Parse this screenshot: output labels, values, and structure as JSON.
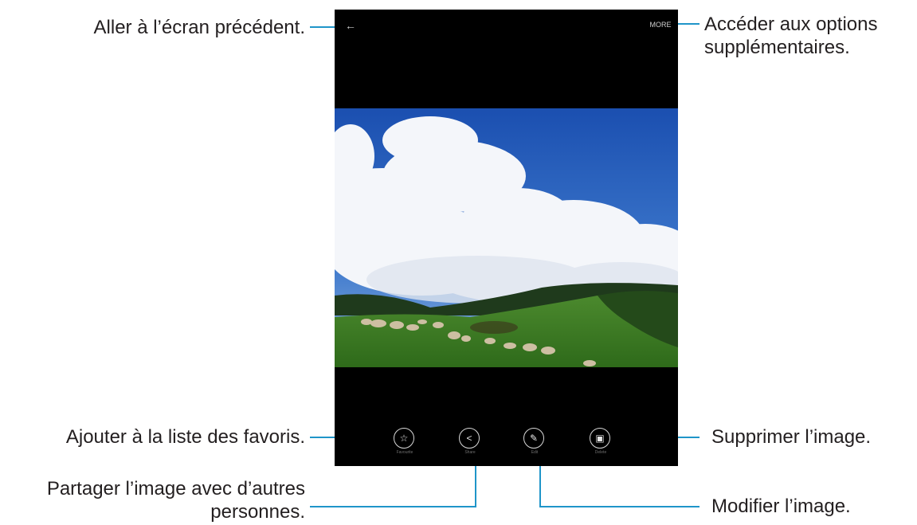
{
  "callouts": {
    "back": "Aller à l’écran précédent.",
    "more": [
      "Accéder aux options",
      "supplémentaires."
    ],
    "favorite": "Ajouter à la liste des favoris.",
    "share": [
      "Partager l’image avec d’autres",
      "personnes."
    ],
    "delete": "Supprimer l’image.",
    "edit": "Modifier l’image."
  },
  "screen": {
    "back_icon": "back-arrow-icon",
    "more_label": "MORE",
    "actions": [
      {
        "icon": "star-icon",
        "label": "Favourite"
      },
      {
        "icon": "share-icon",
        "label": "Share"
      },
      {
        "icon": "pencil-icon",
        "label": "Edit"
      },
      {
        "icon": "trash-icon",
        "label": "Delete"
      }
    ]
  },
  "colors": {
    "callout_line": "#1f95c9",
    "screen_background": "#000000"
  }
}
